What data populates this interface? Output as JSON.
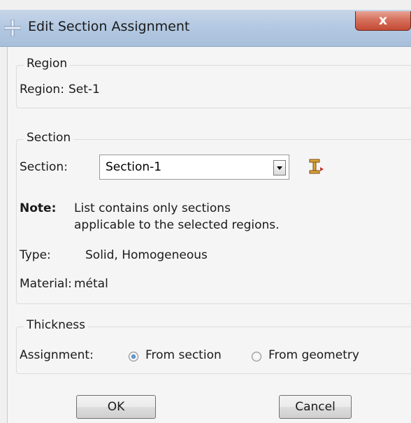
{
  "window": {
    "title": "Edit Section Assignment",
    "close_label": "x"
  },
  "region": {
    "legend": "Region",
    "label": "Region:",
    "value": "Set-1"
  },
  "section": {
    "legend": "Section",
    "label": "Section:",
    "value": "Section-1",
    "note_label": "Note:",
    "note_line1": "List contains only sections",
    "note_line2": "applicable to the selected regions.",
    "type_label": "Type:",
    "type_value": "Solid, Homogeneous",
    "material_label": "Material:",
    "material_value": "métal"
  },
  "thickness": {
    "legend": "Thickness",
    "label": "Assignment:",
    "options": [
      {
        "label": "From section",
        "selected": true
      },
      {
        "label": "From geometry",
        "selected": false
      }
    ]
  },
  "buttons": {
    "ok": "OK",
    "cancel": "Cancel"
  },
  "icons": {
    "title": "abaqus-cross-icon",
    "section_manager": "section-manager-icon"
  }
}
